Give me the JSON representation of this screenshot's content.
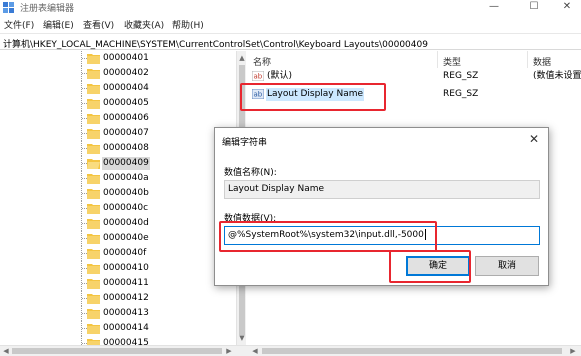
{
  "window": {
    "title": "注册表编辑器",
    "controls": {
      "minimize": "—",
      "maximize": "☐",
      "close": "✕"
    }
  },
  "menu": [
    "文件(F)",
    "编辑(E)",
    "查看(V)",
    "收藏夹(A)",
    "帮助(H)"
  ],
  "address": "计算机\\HKEY_LOCAL_MACHINE\\SYSTEM\\CurrentControlSet\\Control\\Keyboard Layouts\\00000409",
  "tree": {
    "items": [
      "00000401",
      "00000402",
      "00000404",
      "00000405",
      "00000406",
      "00000407",
      "00000408",
      "00000409",
      "0000040a",
      "0000040b",
      "0000040c",
      "0000040d",
      "0000040e",
      "0000040f",
      "00000410",
      "00000411",
      "00000412",
      "00000413",
      "00000414",
      "00000415"
    ],
    "selected": "00000409"
  },
  "values": {
    "columns": {
      "name": "名称",
      "type": "类型",
      "data": "数据"
    },
    "rows": [
      {
        "name": "(默认)",
        "type": "REG_SZ",
        "data": "(数值未设置"
      },
      {
        "name": "Layout Display Name",
        "type": "REG_SZ",
        "data": ""
      }
    ]
  },
  "dialog": {
    "title": "编辑字符串",
    "value_name_label": "数值名称(N):",
    "value_name": "Layout Display Name",
    "value_data_label": "数值数据(V):",
    "value_data": "@%SystemRoot%\\system32\\input.dll,-5000",
    "ok_label": "确定",
    "cancel_label": "取消",
    "close_glyph": "✕"
  },
  "colors": {
    "highlight": "#e8262f",
    "folder": "#f4c542",
    "selection": "#d9d9d9",
    "accent": "#0078d7"
  },
  "scroll": {
    "up": "▲",
    "down": "▼",
    "left": "◀",
    "right": "▶"
  }
}
